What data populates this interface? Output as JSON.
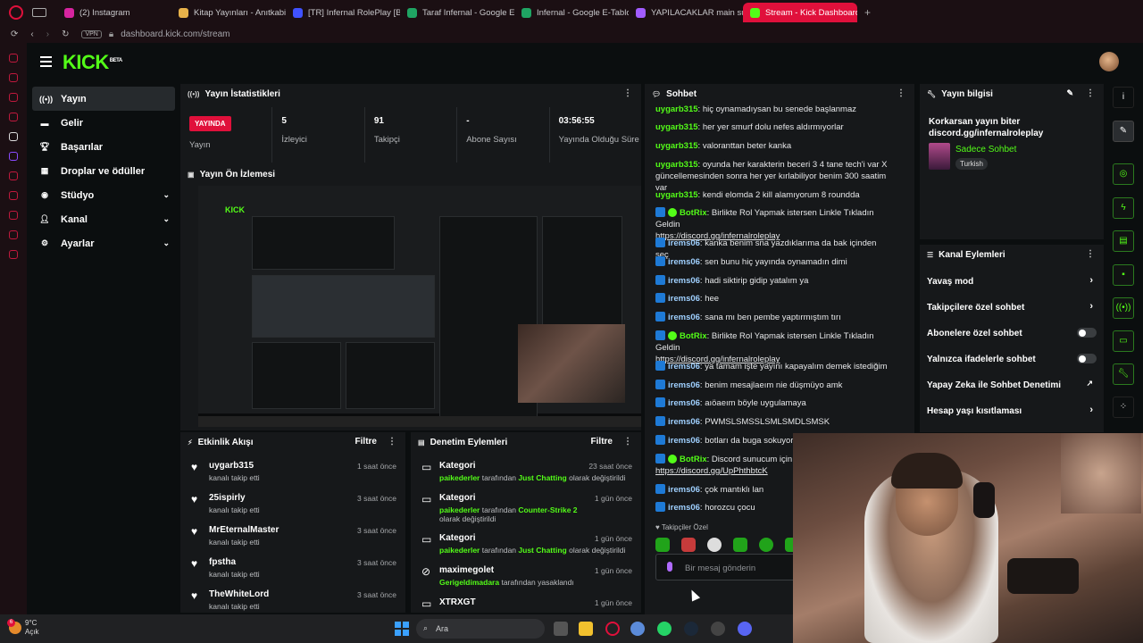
{
  "browser": {
    "tabs": [
      {
        "label": "(2) Instagram",
        "color": "#d6249f"
      },
      {
        "label": "Kitap Yayınları - Anıtkabir",
        "color": "#e8b24a"
      },
      {
        "label": "[TR] Infernal RolePlay [B8",
        "color": "#4052ff"
      },
      {
        "label": "Taraf Infernal - Google E-",
        "color": "#1fa463"
      },
      {
        "label": "Infernal - Google E-Tablo",
        "color": "#1fa463"
      },
      {
        "label": "YAPILACAKLAR main sun",
        "color": "#a15cff"
      },
      {
        "label": "Stream - Kick Dashboard",
        "color": "#53fc18"
      }
    ],
    "new_tab": "+",
    "vpn": "VPN",
    "url": "dashboard.kick.com/stream"
  },
  "brand": {
    "logo": "KICK",
    "beta": "BETA",
    "accent": "#53fc18",
    "live_red": "#e0103b"
  },
  "sidebar": {
    "items": [
      {
        "label": "Yayın",
        "icon": "broadcast-icon"
      },
      {
        "label": "Gelir",
        "icon": "money-icon"
      },
      {
        "label": "Başarılar",
        "icon": "trophy-icon"
      },
      {
        "label": "Droplar ve ödüller",
        "icon": "gift-icon"
      },
      {
        "label": "Stüdyo",
        "icon": "studio-icon"
      },
      {
        "label": "Kanal",
        "icon": "person-icon"
      },
      {
        "label": "Ayarlar",
        "icon": "gear-icon"
      }
    ]
  },
  "stats": {
    "title": "Yayın İstatistikleri",
    "live_badge": "YAYINDA",
    "live_label": "Yayın",
    "viewers_value": "5",
    "viewers_label": "İzleyici",
    "followers_value": "91",
    "followers_label": "Takipçi",
    "subs_value": "-",
    "subs_label": "Abone Sayısı",
    "uptime_value": "03:56:55",
    "uptime_label": "Yayında Olduğu Süre"
  },
  "preview": {
    "title": "Yayın Ön İzlemesi"
  },
  "activity": {
    "title": "Etkinlik Akışı",
    "filter": "Filtre",
    "rows": [
      {
        "name": "uygarb315",
        "sub": "kanalı takip etti",
        "time": "1 saat önce"
      },
      {
        "name": "25ispirly",
        "sub": "kanalı takip etti",
        "time": "3 saat önce"
      },
      {
        "name": "MrEternalMaster",
        "sub": "kanalı takip etti",
        "time": "3 saat önce"
      },
      {
        "name": "fpstha",
        "sub": "kanalı takip etti",
        "time": "3 saat önce"
      },
      {
        "name": "TheWhiteLord",
        "sub": "kanalı takip etti",
        "time": "3 saat önce"
      }
    ]
  },
  "moderation": {
    "title": "Denetim Eylemleri",
    "filter": "Filtre",
    "rows": [
      {
        "name": "Kategori",
        "actor": "paikederler",
        "mid": "tarafından",
        "target": "Just Chatting",
        "end": "olarak değiştirildi",
        "time": "23 saat önce"
      },
      {
        "name": "Kategori",
        "actor": "paikederler",
        "mid": "tarafından",
        "target": "Counter-Strike 2",
        "end": "olarak değiştirildi",
        "time": "1 gün önce"
      },
      {
        "name": "Kategori",
        "actor": "paikederler",
        "mid": "tarafından",
        "target": "Just Chatting",
        "end": "olarak değiştirildi",
        "time": "1 gün önce"
      },
      {
        "name": "maximegolet",
        "actor": "Gerigeldimadara",
        "mid": "tarafından yasaklandı",
        "target": "",
        "end": "",
        "time": "1 gün önce"
      },
      {
        "name": "XTRXGT",
        "actor": "",
        "mid": "",
        "target": "",
        "end": "",
        "time": "1 gün önce"
      }
    ]
  },
  "chat": {
    "title": "Sohbet",
    "messages": [
      {
        "user": "uygarb315",
        "type": "ug",
        "text": "hiç oynamadıysan bu senede başlanmaz"
      },
      {
        "user": "uygarb315",
        "type": "ug",
        "text": "her yer smurf dolu nefes aldırmıyorlar"
      },
      {
        "user": "uygarb315",
        "type": "ug",
        "text": "valoranttan beter kanka"
      },
      {
        "user": "uygarb315",
        "type": "ug",
        "text": "oyunda her karakterin beceri 3 4 tane tech'i var X güncellemesinden sonra her yer kırlabiliyor benim 300 saatim var"
      },
      {
        "user": "uygarb315",
        "type": "ug",
        "text": "kendi elomda 2 kill alamıyorum 8 roundda"
      },
      {
        "user": "BotRix",
        "type": "bot",
        "text": "Birlikte Rol Yapmak istersen Linkle Tıkladın Geldin",
        "link": "https://discord.gg/infernalroleplay"
      },
      {
        "user": "irems06",
        "type": "ir",
        "text": "kanka benim sna yazdıklarıma da bak içinden seç"
      },
      {
        "user": "irems06",
        "type": "ir",
        "text": "sen bunu hiç yayında oynamadın dimi"
      },
      {
        "user": "irems06",
        "type": "ir",
        "text": "hadi siktirip gidip yatalım ya"
      },
      {
        "user": "irems06",
        "type": "ir",
        "text": "hee"
      },
      {
        "user": "irems06",
        "type": "ir",
        "text": "sana mı ben pembe yaptırmıştım tırı"
      },
      {
        "user": "BotRix",
        "type": "bot",
        "text": "Birlikte Rol Yapmak istersen Linkle Tıkladın Geldin",
        "link": "https://discord.gg/infernalroleplay"
      },
      {
        "user": "irems06",
        "type": "ir",
        "text": "ya tamam işte yayını kapayalım demek istediğim"
      },
      {
        "user": "irems06",
        "type": "ir",
        "text": "benim mesajlaeım nie düşmüyo amk"
      },
      {
        "user": "irems06",
        "type": "ir",
        "text": "aıöaeım böyle uygulamaya"
      },
      {
        "user": "irems06",
        "type": "ir",
        "text": "PWMSLSMSSLSMLSMDLSMSK"
      },
      {
        "user": "irems06",
        "type": "ir",
        "text": "botları da buga sokuyor"
      },
      {
        "user": "BotRix",
        "type": "bot",
        "text": "Discord sunucum için",
        "link": "https://discord.gg/UpPhthbtcK"
      },
      {
        "user": "irems06",
        "type": "ir",
        "text": "çok mantıklı lan"
      },
      {
        "user": "irems06",
        "type": "ir",
        "text": "horozcu çocu"
      }
    ],
    "followers_only": "Takipçiler Özel",
    "input_placeholder": "Bir mesaj gönderin"
  },
  "stream_info": {
    "title": "Yayın bilgisi",
    "stream_title": "Korkarsan yayın biter discord.gg/infernalroleplay",
    "category": "Sadece Sohbet",
    "language": "Turkish"
  },
  "channel_actions": {
    "title": "Kanal Eylemleri",
    "items": [
      {
        "label": "Yavaş mod",
        "control": "arrow"
      },
      {
        "label": "Takipçilere özel sohbet",
        "control": "arrow"
      },
      {
        "label": "Abonelere özel sohbet",
        "control": "toggle"
      },
      {
        "label": "Yalnızca ifadelerle sohbet",
        "control": "toggle"
      },
      {
        "label": "Yapay Zeka ile Sohbet Denetimi",
        "control": "external"
      },
      {
        "label": "Hesap yaşı kısıtlaması",
        "control": "arrow"
      }
    ]
  },
  "taskbar": {
    "temp": "9°C",
    "weather_label": "Açık",
    "weather_badge": "6",
    "search_placeholder": "Ara"
  }
}
